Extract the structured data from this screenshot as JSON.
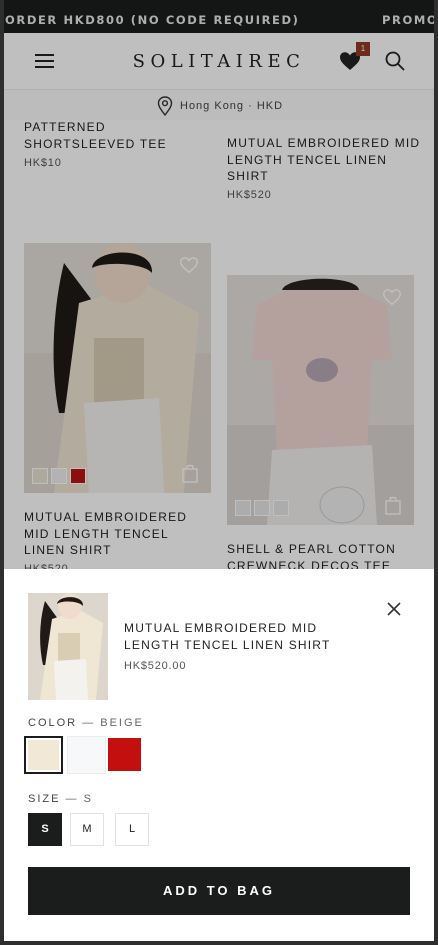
{
  "promo": {
    "text_left": "ORDER HKD800 (NO CODE REQUIRED)",
    "text_right": "PROMO"
  },
  "header": {
    "brand": "SOLITAIREC",
    "wishlist_count": "1"
  },
  "location": {
    "text": "Hong Kong · HKD"
  },
  "products": [
    {
      "name": "PATTERNED SHORTSLEEVED TEE",
      "price": "HK$10"
    },
    {
      "name": "MUTUAL EMBROIDERED MID LENGTH TENCEL LINEN SHIRT",
      "price": "HK$520"
    },
    {
      "name": "MUTUAL EMBROIDERED MID LENGTH TENCEL LINEN SHIRT",
      "price": "HK$520",
      "swatches": [
        "#e9e2d2",
        "#efefef",
        "#b81414"
      ]
    },
    {
      "name": "SHELL & PEARL COTTON CREWNECK DECOS TEE",
      "price": "",
      "swatches": [
        "#e6e6e6",
        "#e6e6e6",
        "#e6e6e6"
      ]
    }
  ],
  "sheet": {
    "name": "MUTUAL EMBROIDERED MID LENGTH TENCEL LINEN SHIRT",
    "price": "HK$520.00",
    "color_label": "COLOR",
    "color_value": "BEIGE",
    "colors": [
      "#f1e8d5",
      "#f7f8f9",
      "#c40f0f"
    ],
    "size_label": "SIZE",
    "size_value": "S",
    "sizes": [
      "S",
      "M",
      "L"
    ],
    "add_label": "ADD TO BAG"
  },
  "colors": {
    "dark": "#1b1c1c",
    "badge": "#8f3b24",
    "accent_red": "#c40f0f"
  },
  "icons": [
    "menu-icon",
    "heart-icon",
    "search-icon",
    "location-pin-icon",
    "wishlist-heart-icon",
    "shopping-bag-icon",
    "close-icon"
  ]
}
